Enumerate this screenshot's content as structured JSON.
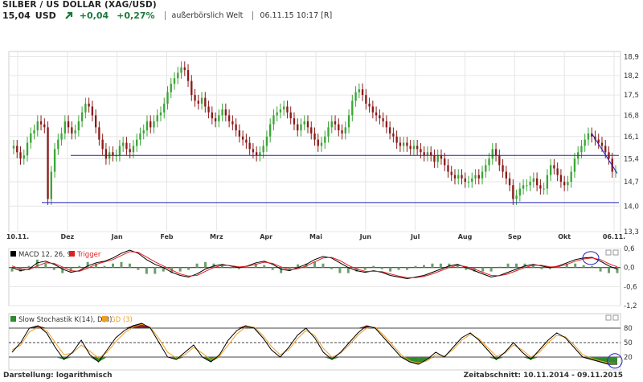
{
  "header": {
    "title": "SILBER / US DOLLAR (XAG/USD)",
    "price": "15,04",
    "currency": "USD",
    "change": "+0,04",
    "change_pct": "+0,27%",
    "exchange": "außerbörslich Welt",
    "timestamp": "06.11.15 10:17 [R]",
    "trend_icon": "arrow-up-right-icon",
    "up_color": "#1a7a3a"
  },
  "footer": {
    "display_mode": "Darstellung: logarithmisch",
    "period": "Zeitabschnitt: 10.11.2014 - 09.11.2015"
  },
  "chart_data": [
    {
      "type": "candlestick",
      "title": "",
      "scale": "log",
      "ylim": [
        13.3,
        19.1
      ],
      "y_ticks": [
        "18,9",
        "18,2",
        "17,5",
        "16,8",
        "16,1",
        "15,4",
        "14,7",
        "14,0",
        "13,3"
      ],
      "x_ticks": [
        "10.11.",
        "Dez",
        "Jan",
        "Feb",
        "Mrz",
        "Apr",
        "Mai",
        "Jun",
        "Jul",
        "Aug",
        "Sep",
        "Okt",
        "06.11."
      ],
      "up_color": "#3aa635",
      "down_color": "#8b1a1a",
      "series": [
        {
          "values": [
            15.8,
            15.6,
            15.4,
            15.5,
            15.9,
            16.2,
            16.3,
            16.6,
            16.5,
            16.4,
            14.2,
            15.0,
            15.7,
            16.0,
            16.2,
            16.6,
            16.4,
            16.2,
            16.3,
            16.6,
            16.9,
            17.2,
            17.1,
            16.8,
            16.4,
            16.0,
            15.7,
            15.4,
            15.6,
            15.5,
            15.5,
            15.8,
            15.9,
            15.7,
            15.6,
            15.8,
            16.0,
            16.2,
            16.3,
            16.6,
            16.4,
            16.6,
            16.8,
            16.9,
            17.2,
            17.6,
            17.9,
            18.1,
            18.3,
            18.5,
            18.4,
            18.0,
            17.5,
            17.3,
            17.2,
            17.4,
            17.1,
            16.9,
            16.7,
            16.6,
            16.8,
            17.0,
            16.8,
            16.6,
            16.5,
            16.3,
            16.1,
            16.0,
            15.9,
            15.7,
            15.6,
            15.5,
            15.6,
            15.8,
            16.1,
            16.5,
            16.8,
            16.9,
            17.0,
            17.1,
            16.9,
            16.7,
            16.5,
            16.3,
            16.5,
            16.6,
            16.4,
            16.2,
            16.0,
            15.8,
            15.9,
            16.1,
            16.4,
            16.6,
            16.5,
            16.3,
            16.2,
            16.4,
            16.8,
            17.3,
            17.6,
            17.7,
            17.5,
            17.2,
            17.1,
            16.9,
            16.8,
            16.7,
            16.6,
            16.4,
            16.2,
            16.1,
            15.9,
            15.8,
            15.9,
            15.8,
            15.7,
            15.8,
            15.7,
            15.6,
            15.5,
            15.6,
            15.5,
            15.3,
            15.5,
            15.4,
            15.2,
            15.0,
            14.9,
            14.8,
            14.9,
            14.8,
            14.7,
            14.7,
            14.8,
            14.9,
            14.8,
            15.0,
            15.2,
            15.4,
            15.7,
            15.5,
            15.2,
            15.0,
            14.8,
            14.6,
            14.2,
            14.3,
            14.5,
            14.6,
            14.6,
            14.7,
            14.8,
            14.6,
            14.5,
            14.5,
            14.9,
            15.2,
            15.1,
            14.9,
            14.7,
            14.6,
            14.7,
            15.0,
            15.4,
            15.6,
            15.8,
            16.0,
            16.2,
            16.1,
            16.0,
            15.9,
            15.8,
            15.6,
            15.4,
            15.0,
            15.02
          ]
        },
        {
          "name": "support",
          "values": [
            14.1,
            14.1
          ]
        },
        {
          "name": "resistance",
          "values": [
            15.5,
            15.5
          ]
        }
      ]
    },
    {
      "type": "line",
      "title": "MACD 12, 26, 9",
      "ylim": [
        -1.2,
        0.6
      ],
      "y_ticks": [
        "0,6",
        "0,0",
        "-0,6",
        "-1,2"
      ],
      "series": [
        {
          "name": "MACD 12, 26, 9",
          "color": "#000000",
          "values": [
            0.0,
            -0.1,
            -0.05,
            0.15,
            0.2,
            0.1,
            -0.05,
            -0.15,
            -0.1,
            0.05,
            0.15,
            0.2,
            0.3,
            0.45,
            0.55,
            0.45,
            0.25,
            0.1,
            0.0,
            -0.15,
            -0.25,
            -0.3,
            -0.2,
            -0.05,
            0.05,
            0.1,
            0.05,
            0.0,
            0.05,
            0.15,
            0.2,
            0.1,
            -0.05,
            -0.1,
            0.0,
            0.1,
            0.25,
            0.35,
            0.3,
            0.15,
            0.0,
            -0.1,
            -0.15,
            -0.1,
            -0.15,
            -0.25,
            -0.3,
            -0.35,
            -0.3,
            -0.25,
            -0.15,
            -0.05,
            0.05,
            0.1,
            0.0,
            -0.1,
            -0.2,
            -0.3,
            -0.25,
            -0.15,
            -0.05,
            0.05,
            0.1,
            0.05,
            0.0,
            0.05,
            0.15,
            0.25,
            0.3,
            0.32,
            0.2,
            0.05,
            -0.05
          ]
        },
        {
          "name": "Trigger",
          "color": "#e02020",
          "values": [
            0.05,
            -0.05,
            -0.07,
            0.05,
            0.15,
            0.13,
            0.02,
            -0.1,
            -0.12,
            -0.02,
            0.1,
            0.18,
            0.25,
            0.38,
            0.5,
            0.48,
            0.33,
            0.18,
            0.05,
            -0.08,
            -0.2,
            -0.27,
            -0.25,
            -0.12,
            0.0,
            0.07,
            0.06,
            0.02,
            0.04,
            0.1,
            0.17,
            0.13,
            0.02,
            -0.07,
            -0.04,
            0.05,
            0.18,
            0.3,
            0.32,
            0.22,
            0.07,
            -0.05,
            -0.12,
            -0.12,
            -0.13,
            -0.2,
            -0.27,
            -0.32,
            -0.32,
            -0.28,
            -0.2,
            -0.1,
            0.0,
            0.07,
            0.03,
            -0.05,
            -0.15,
            -0.25,
            -0.26,
            -0.2,
            -0.1,
            0.0,
            0.07,
            0.07,
            0.02,
            0.03,
            0.1,
            0.2,
            0.27,
            0.3,
            0.25,
            0.12,
            0.02
          ]
        }
      ]
    },
    {
      "type": "line",
      "title": "Slow Stochastik K(14), D(3)",
      "ylim": [
        0,
        100
      ],
      "y_ticks": [
        "80",
        "50",
        "20"
      ],
      "series": [
        {
          "name": "Slow Stochastik K(14), D(3)",
          "color": "#000000",
          "values": [
            30,
            50,
            80,
            85,
            70,
            40,
            15,
            30,
            55,
            25,
            10,
            35,
            60,
            75,
            85,
            90,
            80,
            50,
            20,
            15,
            30,
            45,
            20,
            10,
            25,
            55,
            75,
            85,
            80,
            60,
            35,
            20,
            40,
            65,
            80,
            60,
            30,
            15,
            30,
            50,
            70,
            85,
            80,
            60,
            40,
            20,
            10,
            5,
            15,
            30,
            20,
            40,
            60,
            70,
            55,
            35,
            15,
            30,
            50,
            30,
            15,
            35,
            55,
            70,
            60,
            40,
            20,
            15,
            10,
            5,
            5
          ]
        },
        {
          "name": "GD (3)",
          "color": "#f0a020",
          "values": [
            35,
            45,
            72,
            82,
            75,
            50,
            25,
            28,
            45,
            32,
            18,
            30,
            52,
            70,
            82,
            88,
            82,
            58,
            30,
            18,
            25,
            40,
            28,
            15,
            22,
            45,
            68,
            82,
            82,
            65,
            42,
            25,
            35,
            58,
            75,
            65,
            38,
            20,
            28,
            45,
            65,
            80,
            82,
            65,
            45,
            25,
            12,
            8,
            12,
            25,
            22,
            35,
            55,
            67,
            58,
            40,
            22,
            28,
            45,
            35,
            20,
            30,
            50,
            65,
            62,
            45,
            25,
            18,
            12,
            8,
            6
          ]
        }
      ]
    }
  ]
}
